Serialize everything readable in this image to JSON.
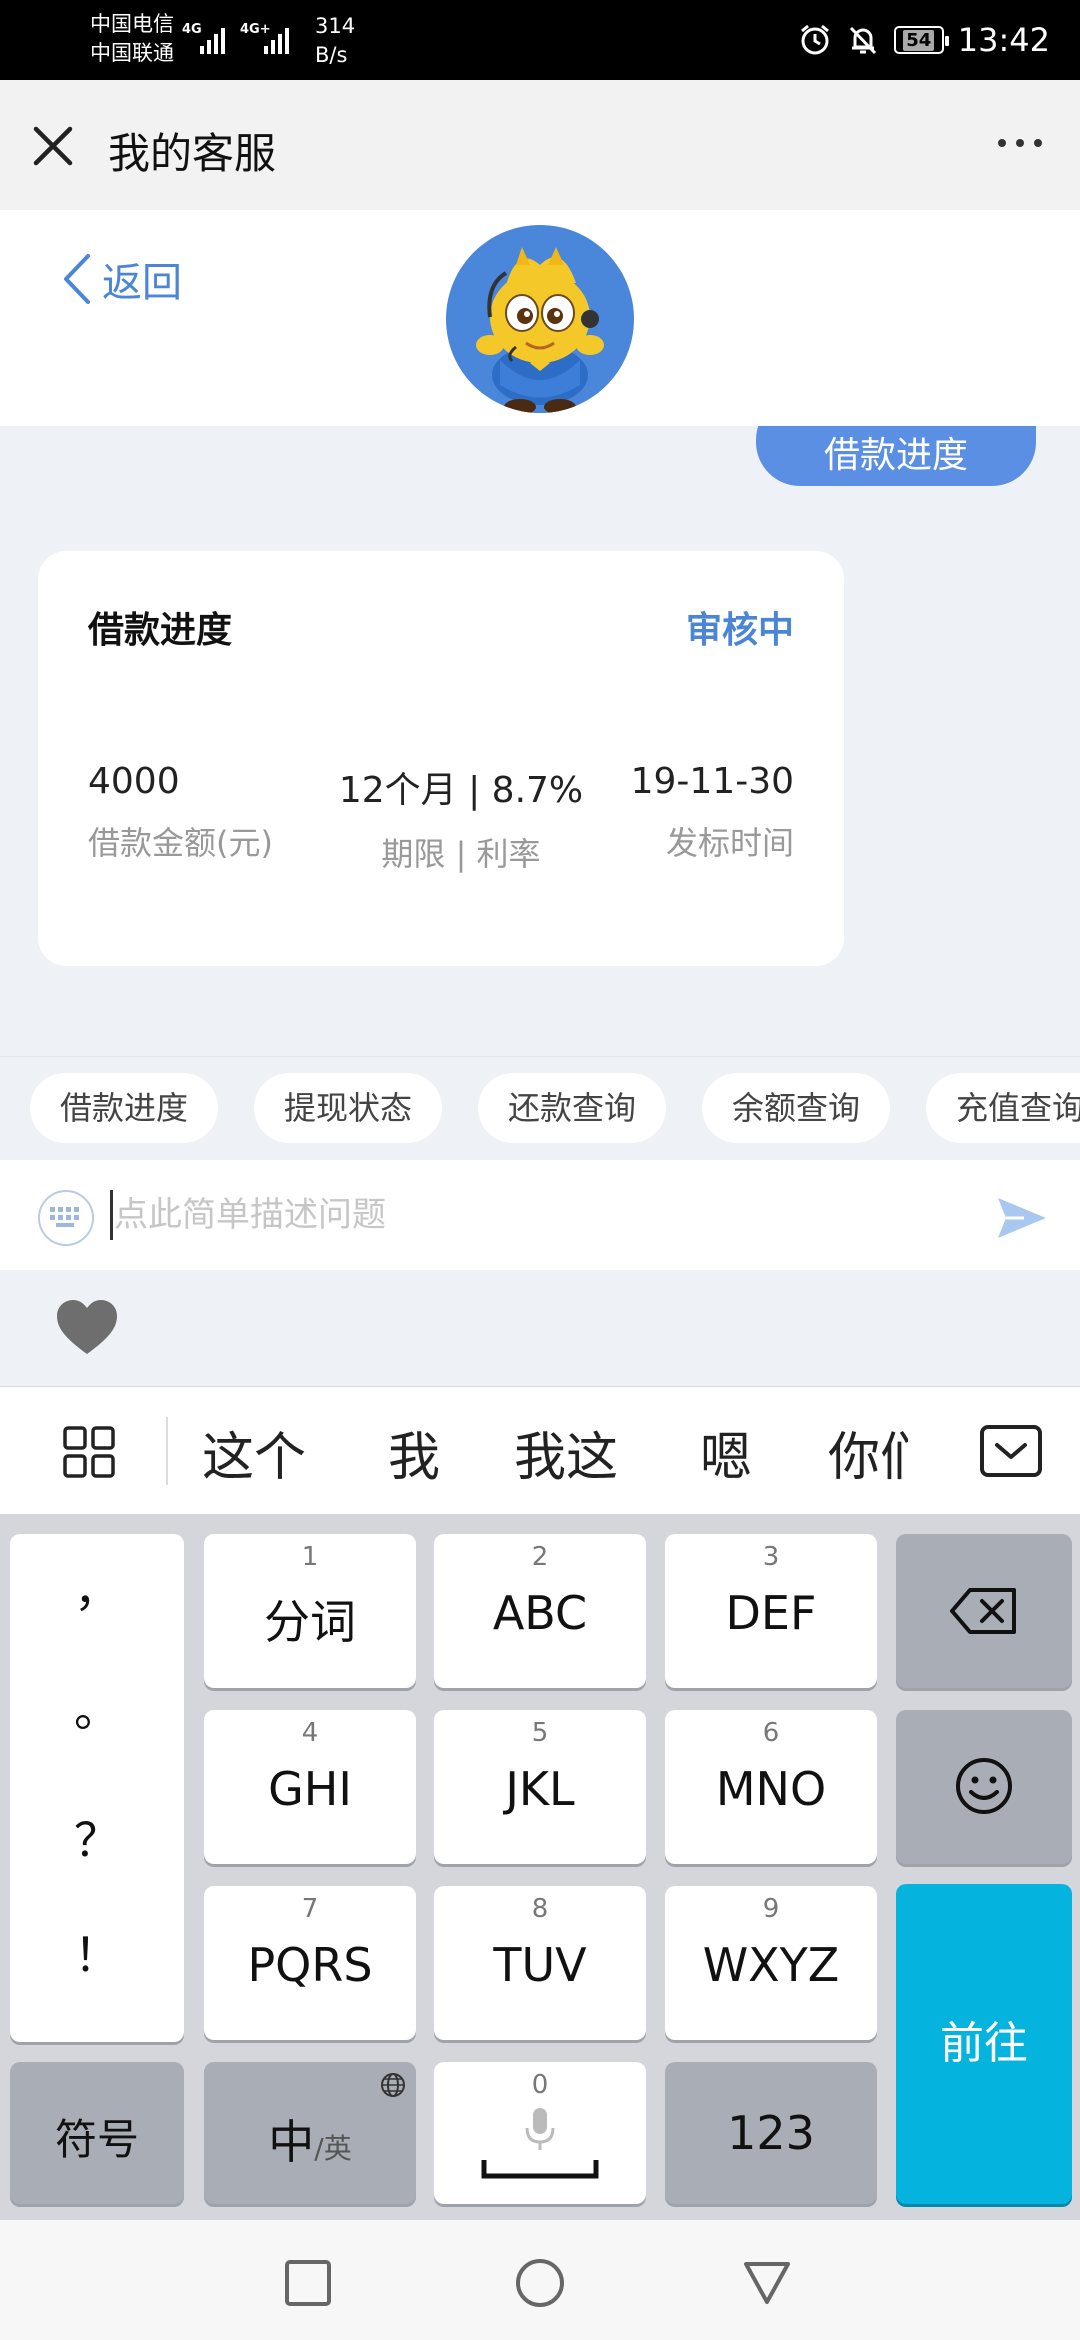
{
  "status_bar": {
    "carrier_1": "中国电信",
    "carrier_2": "中国联通",
    "net_1": "4G",
    "net_2": "4G+",
    "speed_value": "314",
    "speed_unit": "B/s",
    "battery": "54",
    "time": "13:42"
  },
  "title_bar": {
    "title": "我的客服"
  },
  "header": {
    "back_label": "返回"
  },
  "chat": {
    "user_message": "借款进度",
    "card": {
      "title": "借款进度",
      "status": "审核中",
      "status_color": "#4a85d8",
      "stats": [
        {
          "value": "4000",
          "label": "借款金额(元)"
        },
        {
          "value": "12个月 | 8.7%",
          "label": "期限 | 利率"
        },
        {
          "value": "19-11-30",
          "label": "发标时间"
        }
      ]
    }
  },
  "quick_replies": [
    "借款进度",
    "提现状态",
    "还款查询",
    "余额查询",
    "充值查询"
  ],
  "input": {
    "placeholder": "点此简单描述问题",
    "value": ""
  },
  "candidates": [
    "这个",
    "我",
    "我这",
    "嗯",
    "你们"
  ],
  "keyboard": {
    "punctuation": [
      "，",
      "。",
      "？",
      "！"
    ],
    "keys": [
      {
        "num": "1",
        "label": "分词"
      },
      {
        "num": "2",
        "label": "ABC"
      },
      {
        "num": "3",
        "label": "DEF"
      },
      {
        "num": "4",
        "label": "GHI"
      },
      {
        "num": "5",
        "label": "JKL"
      },
      {
        "num": "6",
        "label": "MNO"
      },
      {
        "num": "7",
        "label": "PQRS"
      },
      {
        "num": "8",
        "label": "TUV"
      },
      {
        "num": "9",
        "label": "WXYZ"
      }
    ],
    "symbols_label": "符号",
    "lang_main": "中",
    "lang_sub": "/英",
    "space_num": "0",
    "numbers_label": "123",
    "go_label": "前往",
    "accent_color": "#04b3de"
  },
  "icons": {
    "close": "close-icon",
    "more": "more-icon",
    "back": "chevron-left-icon",
    "keyboard": "keyboard-icon",
    "send": "send-icon",
    "heart": "heart-icon",
    "grid": "grid-icon",
    "collapse": "chevron-down-icon",
    "backspace": "backspace-icon",
    "emoji": "emoji-icon",
    "globe": "globe-icon",
    "mic": "mic-icon"
  }
}
